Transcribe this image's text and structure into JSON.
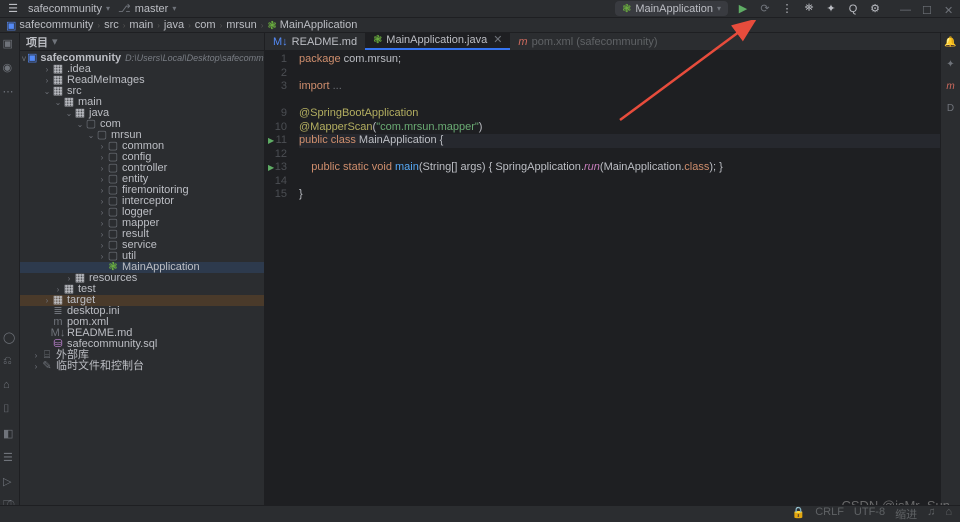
{
  "titlebar": {
    "project": "safecommunity",
    "branch": "master",
    "run_config": "MainApplication",
    "icons": {
      "menu": "≡",
      "run": "▶",
      "debug": "⟳",
      "more": "⋮",
      "user": "⛯",
      "ai": "✦",
      "search": "Q",
      "settings": "⚙",
      "min": "—",
      "max": "☐",
      "close": "✕"
    }
  },
  "breadcrumb": {
    "items": [
      "safecommunity",
      "src",
      "main",
      "java",
      "com",
      "mrsun",
      "MainApplication"
    ]
  },
  "project_panel": {
    "title": "项目",
    "selector": "▾",
    "root": {
      "name": "safecommunity",
      "path": "D:\\Users\\Local\\Desktop\\safecommunity"
    },
    "tree": [
      {
        "d": 1,
        "a": ">",
        "i": "folder",
        "t": ".idea"
      },
      {
        "d": 1,
        "a": ">",
        "i": "folder",
        "t": "ReadMeImages"
      },
      {
        "d": 1,
        "a": "v",
        "i": "folder",
        "t": "src"
      },
      {
        "d": 2,
        "a": "v",
        "i": "folder",
        "t": "main"
      },
      {
        "d": 3,
        "a": "v",
        "i": "folder",
        "t": "java"
      },
      {
        "d": 4,
        "a": "v",
        "i": "pkg",
        "t": "com"
      },
      {
        "d": 5,
        "a": "v",
        "i": "pkg",
        "t": "mrsun"
      },
      {
        "d": 6,
        "a": ">",
        "i": "pkg",
        "t": "common"
      },
      {
        "d": 6,
        "a": ">",
        "i": "pkg",
        "t": "config"
      },
      {
        "d": 6,
        "a": ">",
        "i": "pkg",
        "t": "controller"
      },
      {
        "d": 6,
        "a": ">",
        "i": "pkg",
        "t": "entity"
      },
      {
        "d": 6,
        "a": ">",
        "i": "pkg",
        "t": "firemonitoring"
      },
      {
        "d": 6,
        "a": ">",
        "i": "pkg",
        "t": "interceptor"
      },
      {
        "d": 6,
        "a": ">",
        "i": "pkg",
        "t": "logger"
      },
      {
        "d": 6,
        "a": ">",
        "i": "pkg",
        "t": "mapper"
      },
      {
        "d": 6,
        "a": ">",
        "i": "pkg",
        "t": "result"
      },
      {
        "d": 6,
        "a": ">",
        "i": "pkg",
        "t": "service"
      },
      {
        "d": 6,
        "a": ">",
        "i": "pkg",
        "t": "util"
      },
      {
        "d": 6,
        "a": "",
        "i": "spring",
        "t": "MainApplication",
        "sel": true
      },
      {
        "d": 3,
        "a": ">",
        "i": "folder",
        "t": "resources"
      },
      {
        "d": 2,
        "a": ">",
        "i": "folder",
        "t": "test"
      },
      {
        "d": 1,
        "a": ">",
        "i": "folder",
        "t": "target",
        "tgt": true
      },
      {
        "d": 1,
        "a": "",
        "i": "file",
        "t": "desktop.ini"
      },
      {
        "d": 1,
        "a": "",
        "i": "maven",
        "t": "pom.xml"
      },
      {
        "d": 1,
        "a": "",
        "i": "md",
        "t": "README.md"
      },
      {
        "d": 1,
        "a": "",
        "i": "sql",
        "t": "safecommunity.sql"
      },
      {
        "d": 0,
        "a": ">",
        "i": "lib",
        "t": "外部库"
      },
      {
        "d": 0,
        "a": ">",
        "i": "scratch",
        "t": "临时文件和控制台"
      }
    ]
  },
  "tabs": [
    {
      "icon": "md",
      "label": "README.md",
      "active": false
    },
    {
      "icon": "spring",
      "label": "MainApplication.java",
      "active": true
    },
    {
      "icon": "maven",
      "label": "pom.xml (safecommunity)",
      "active": false,
      "grey": true
    }
  ],
  "code": {
    "lines": [
      {
        "n": "1",
        "html": "<span class='k-key'>package</span> <span class='k-cls'>com.mrsun;</span>"
      },
      {
        "n": "2",
        "html": ""
      },
      {
        "n": "3",
        "html": "<span class='k-key'>import</span> <span class='k-grey'>...</span>"
      },
      {
        "n": "",
        "html": ""
      },
      {
        "n": "9",
        "html": "<span class='k-ann'>@SpringBootApplication</span>"
      },
      {
        "n": "10",
        "html": "<span class='k-ann'>@MapperScan</span>(<span class='k-str'>\"com.mrsun.mapper\"</span>)"
      },
      {
        "n": "11",
        "html": "<span class='k-key'>public class</span> <span class='k-cls'>MainApplication</span> {",
        "hl": true,
        "run": true
      },
      {
        "n": "12",
        "html": ""
      },
      {
        "n": "13",
        "html": "    <span class='k-key'>public static void</span> <span class='k-meth'>main</span>(<span class='k-cls'>String</span>[] <span class='k-param'>args</span>) { <span class='k-cls'>SpringApplication</span>.<span class='k-ident'>run</span>(<span class='k-cls'>MainApplication</span>.<span class='k-key'>class</span>); }",
        "run": true
      },
      {
        "n": "14",
        "html": ""
      },
      {
        "n": "15",
        "html": "}"
      }
    ]
  },
  "watermark": "CSDN @isMr_Sun",
  "statusbar": {
    "items": [
      "🔒",
      "CRLF",
      "UTF-8",
      "缩进",
      "♫",
      "⌂"
    ]
  }
}
